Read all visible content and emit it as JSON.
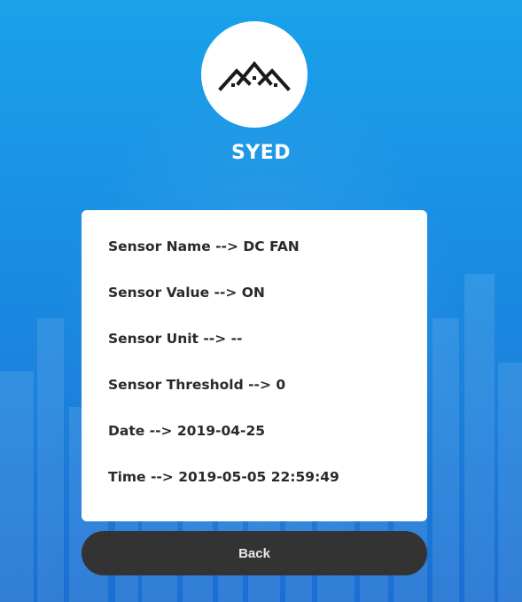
{
  "header": {
    "logo_icon": "houses-roof-icon",
    "title": "SYED"
  },
  "sensor": {
    "name": "Sensor Name --> DC FAN",
    "value": "Sensor Value --> ON",
    "unit": "Sensor Unit --> --",
    "threshold": "Sensor Threshold --> 0",
    "date": "Date --> 2019-04-25",
    "time": "Time --> 2019-05-05 22:59:49"
  },
  "actions": {
    "back_label": "Back"
  },
  "colors": {
    "background_top": "#1aa2ea",
    "background_bottom": "#1a6fd2",
    "card": "#ffffff",
    "button": "#333333",
    "text": "#2a2a2a"
  }
}
